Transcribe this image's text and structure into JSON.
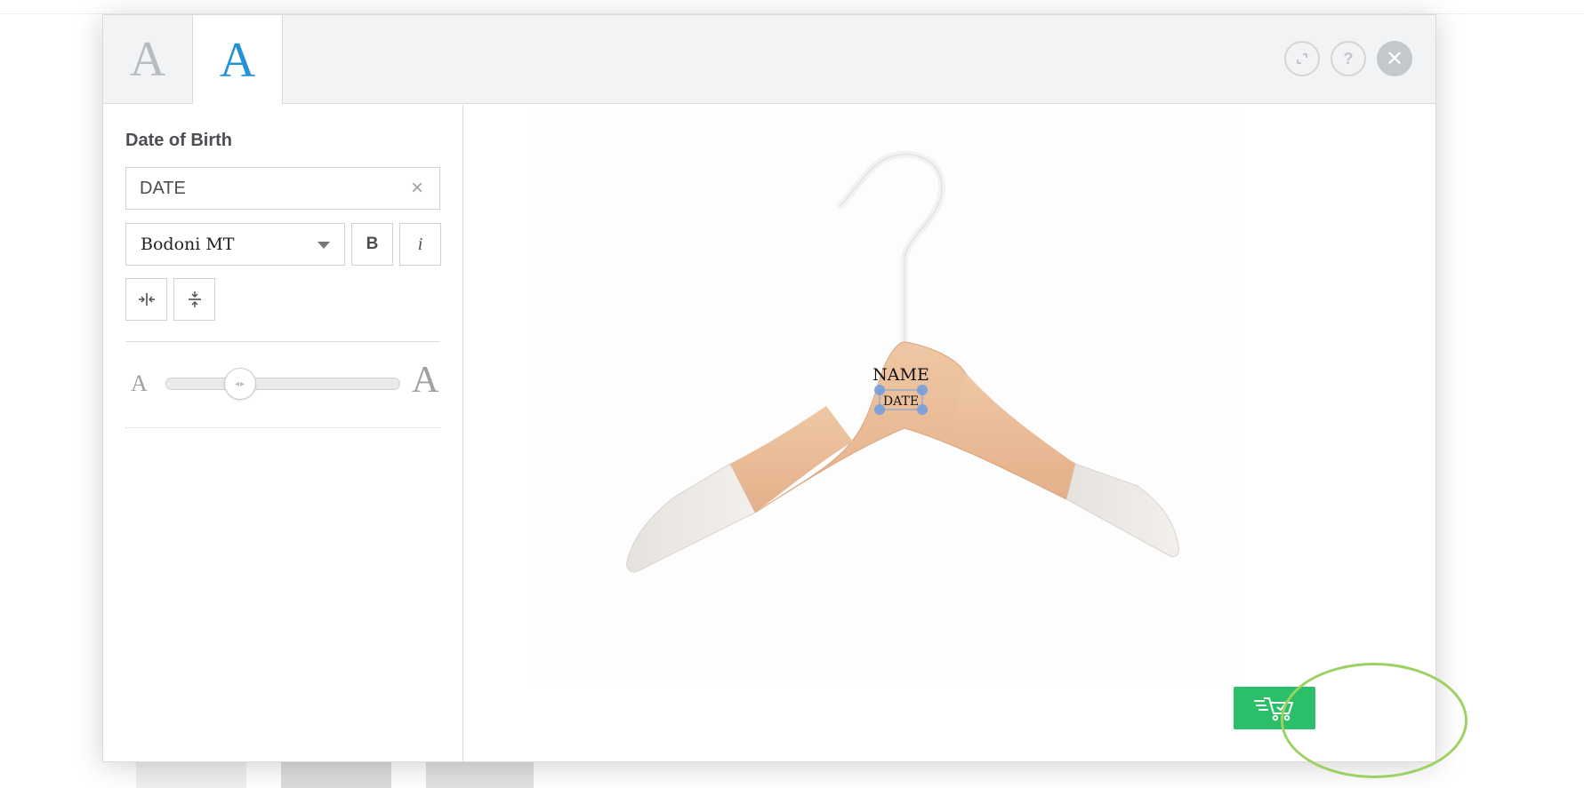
{
  "header": {
    "tabs": [
      {
        "label": "A",
        "state": "inactive"
      },
      {
        "label": "A",
        "state": "active"
      }
    ],
    "buttons": {
      "expand_icon": "expand-icon",
      "help_label": "?",
      "close_label": "✕"
    }
  },
  "sidebar": {
    "field_label": "Date of Birth",
    "text_value": "DATE",
    "clear_label": "×",
    "font_name": "Bodoni MT",
    "bold_label": "B",
    "italic_label": "i",
    "size_small_label": "A",
    "size_large_label": "A",
    "font_size_fraction": 0.25
  },
  "canvas": {
    "line1": "NAME",
    "line2": "DATE"
  },
  "cart_icon": "cart-check-icon",
  "colors": {
    "accent": "#2492d6",
    "cart": "#2bbf6a",
    "highlight_ring": "#9ed164",
    "handle": "#6f9de0"
  }
}
